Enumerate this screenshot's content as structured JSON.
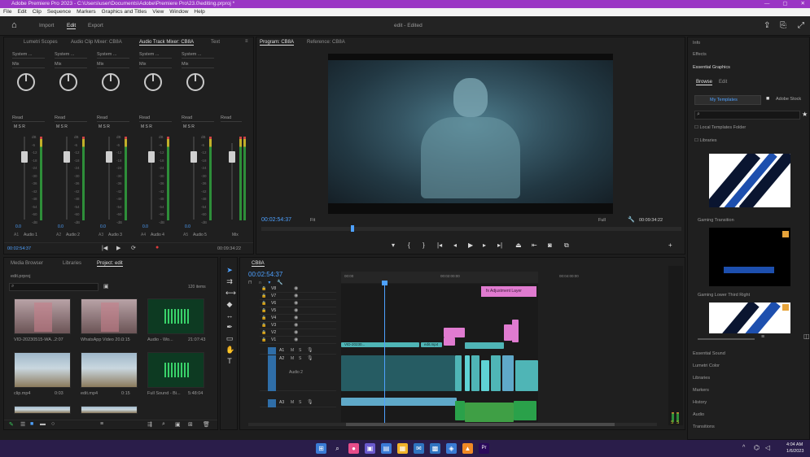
{
  "window": {
    "title": "Adobe Premiere Pro 2023 - C:\\Users\\user\\Documents\\Adobe\\Premiere Pro\\23.0\\editing.prproj *",
    "controls": [
      "minimize-icon",
      "maximize-icon",
      "close-icon"
    ]
  },
  "menu": [
    "File",
    "Edit",
    "Clip",
    "Sequence",
    "Markers",
    "Graphics and Titles",
    "View",
    "Window",
    "Help"
  ],
  "workspace": {
    "home_icon": "home-icon",
    "items": [
      "Import",
      "Edit",
      "Export"
    ],
    "active": "Edit",
    "project_name": "edit - Edited",
    "right_icons": [
      "quick-export-icon",
      "share-icon",
      "fullscreen-icon"
    ]
  },
  "audio_mixer": {
    "tabs": [
      "Lumetri Scopes",
      "Audio Clip Mixer: CB8A",
      "Audio Track Mixer: CB8A",
      "Text"
    ],
    "active_tab": "Audio Track Mixer: CB8A",
    "channels": [
      {
        "input": "System ...",
        "mode": "Mix",
        "automation": "Read",
        "ms": "M  S  R",
        "name": "Audio 1",
        "db": "0.0",
        "id": "A1"
      },
      {
        "input": "System ...",
        "mode": "Mix",
        "automation": "Read",
        "ms": "M  S  R",
        "name": "Audio 2",
        "db": "0.0",
        "id": "A2"
      },
      {
        "input": "System ...",
        "mode": "Mix",
        "automation": "Read",
        "ms": "M  S  R",
        "name": "Audio 3",
        "db": "0.0",
        "id": "A3"
      },
      {
        "input": "System ...",
        "mode": "Mix",
        "automation": "Read",
        "ms": "M  S  R",
        "name": "Audio 4",
        "db": "0.0",
        "id": "A4"
      },
      {
        "input": "System ...",
        "mode": "Mix",
        "automation": "Read",
        "ms": "M  S  R",
        "name": "Audio 5",
        "db": "0.0",
        "id": "A5"
      }
    ],
    "master": {
      "automation": "Read",
      "name": "Mix"
    },
    "scale": [
      "dB",
      "-6",
      "-12",
      "-18",
      "-24",
      "-30",
      "-36",
      "-42",
      "-48",
      "-54",
      "-60",
      "-dB"
    ],
    "timecode_left": "00:02:54:37",
    "timecode_right": "00:09:34:22",
    "transport_icons": [
      "go-to-in-icon",
      "play-stop-icon",
      "loop-icon",
      "record-icon"
    ]
  },
  "program_monitor": {
    "tabs": [
      "Program: CB8A",
      "Reference: CB8A"
    ],
    "active_tab": "Program: CB8A",
    "timecode": "00:02:54:37",
    "fit": "Fit",
    "quality": "Full",
    "duration": "00:09:34:22",
    "controls": [
      "marker-icon",
      "in-point-icon",
      "out-point-icon",
      "go-to-in-icon",
      "step-back-icon",
      "play-icon",
      "step-forward-icon",
      "go-to-out-icon",
      "lift-icon",
      "extract-icon",
      "camera-icon",
      "compare-icon",
      "add-icon"
    ]
  },
  "project_panel": {
    "tabs": [
      "Media Browser",
      "Libraries",
      "Project: edit"
    ],
    "active_tab": "Project: edit",
    "project_file": "edit.prproj",
    "item_count": "120 items",
    "search_placeholder": "",
    "items": [
      {
        "name": "VID-20230515-WA...",
        "duration": "2:07",
        "kind": "video-portrait"
      },
      {
        "name": "WhatsApp Video 20...",
        "duration": "0:15",
        "kind": "video-portrait"
      },
      {
        "name": "Audio - Wo...",
        "duration": "21:07:43",
        "kind": "audio"
      },
      {
        "name": "clip.mp4",
        "duration": "0:03",
        "kind": "video-landscape"
      },
      {
        "name": "edit.mp4",
        "duration": "0:15",
        "kind": "video-landscape"
      },
      {
        "name": "Full Sound - Bi...",
        "duration": "5:48:04",
        "kind": "audio"
      },
      {
        "name": "",
        "duration": "",
        "kind": "video-landscape"
      },
      {
        "name": "",
        "duration": "",
        "kind": "video-landscape"
      }
    ],
    "footer_icons": [
      "pencil-icon",
      "list-view-icon",
      "icon-view-icon",
      "freeform-view-icon",
      "zoom-slider-icon",
      "sort-icon",
      "automate-icon",
      "search-icon",
      "new-bin-icon",
      "new-item-icon",
      "trash-icon"
    ]
  },
  "tools": [
    "selection-tool-icon",
    "track-select-icon",
    "ripple-edit-icon",
    "razor-icon",
    "slip-icon",
    "pen-icon",
    "rectangle-icon",
    "hand-icon",
    "type-tool-icon"
  ],
  "timeline": {
    "tab": "CB8A",
    "timecode": "00:02:54:37",
    "ruler": [
      "00:00",
      "00:02:00:00",
      "00:04:00:00"
    ],
    "adjustment_label": "fx Adjustment Layer",
    "video_tracks": [
      "V8",
      "V7",
      "V6",
      "V5",
      "V4",
      "V3",
      "V2",
      "V1"
    ],
    "audio_tracks": [
      "A1",
      "A2",
      "A3"
    ],
    "audio2_name": "Audio 2",
    "clip_labels": [
      "VID-20230...",
      "edit.mp4"
    ],
    "meter_labels": [
      "S",
      "S"
    ]
  },
  "right_panel": {
    "sections": [
      "Info",
      "Effects",
      "Essential Graphics"
    ],
    "tabs": [
      "Browse",
      "Edit"
    ],
    "active_tab": "Browse",
    "buttons": [
      "My Templates",
      "Adobe Stock"
    ],
    "search_placeholder": "",
    "checkboxes": [
      "Local Templates Folder",
      "Libraries"
    ],
    "templates": [
      "Gaming Transition",
      "Gaming Lower Third Right"
    ],
    "list": [
      "Essential Sound",
      "Lumetri Color",
      "Libraries",
      "Markers",
      "History",
      "Audio",
      "Transitions"
    ]
  },
  "taskbar": {
    "icons": [
      "windows-start-icon",
      "search-icon",
      "colorful-app-icon",
      "task-view-icon",
      "widgets-icon",
      "file-explorer-icon",
      "mail-icon",
      "store-icon",
      "photos-icon",
      "vlc-icon",
      "premiere-icon"
    ],
    "time": "4:04 AM",
    "date": "1/6/2023"
  },
  "colors": {
    "title_bar": "#9a36c4",
    "playhead": "#4ea1ff",
    "clip_teal": "#4fb5b6",
    "clip_pink": "#e07bd0",
    "audio_green": "#3f9f45",
    "taskbar": "#2a1d4a"
  }
}
